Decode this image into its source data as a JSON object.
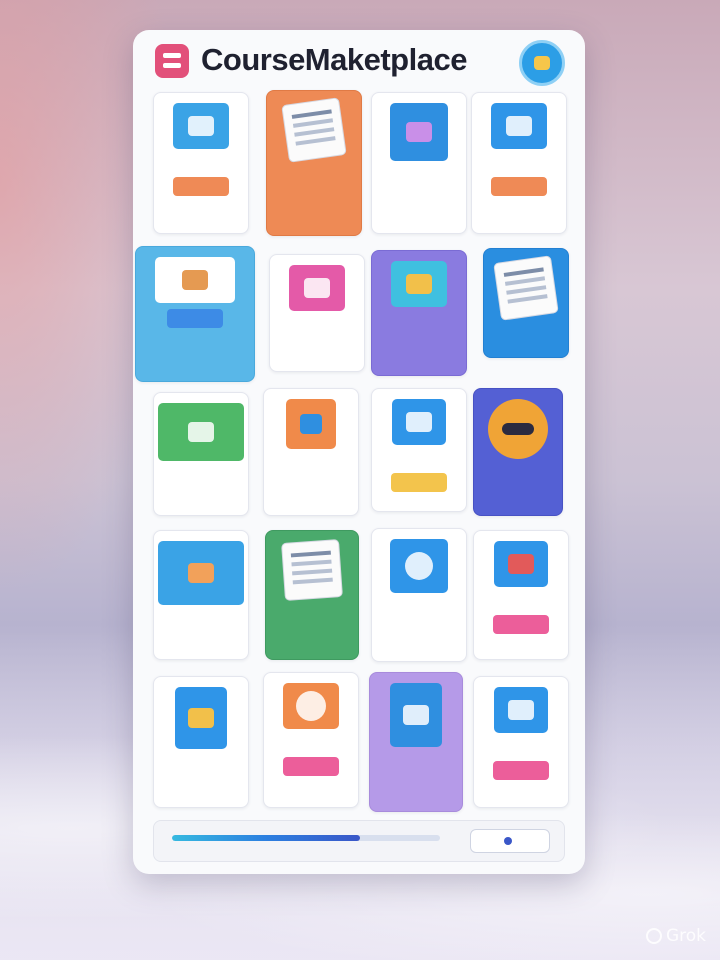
{
  "app": {
    "title": "CourseMaketplace"
  },
  "colors": {
    "accent": "#e2507a",
    "avatar": "#2c9ee6"
  },
  "icons": {
    "logo": "menu-logo-icon",
    "avatar": "profile-avatar-icon"
  },
  "progress": {
    "value": 0.7
  },
  "cards": [],
  "footer": {
    "button_label": ""
  }
}
